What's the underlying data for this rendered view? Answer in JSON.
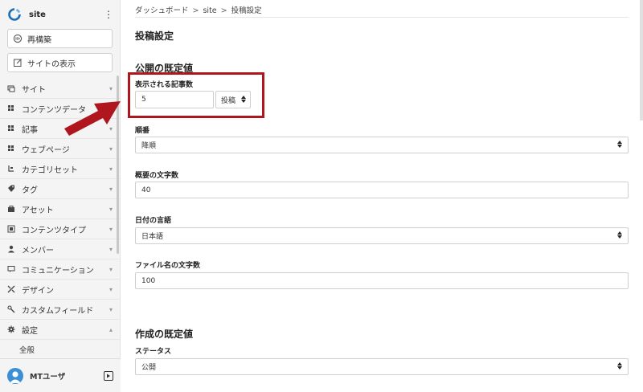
{
  "sidebar": {
    "site_name": "site",
    "buttons": [
      {
        "label": "再構築",
        "icon": "rebuild-icon"
      },
      {
        "label": "サイトの表示",
        "icon": "external-view-icon"
      }
    ],
    "items": [
      {
        "label": "サイト",
        "icon": "site-icon"
      },
      {
        "label": "コンテンツデータ",
        "icon": "content-data-icon"
      },
      {
        "label": "記事",
        "icon": "entry-icon"
      },
      {
        "label": "ウェブページ",
        "icon": "webpage-icon"
      },
      {
        "label": "カテゴリセット",
        "icon": "category-set-icon"
      },
      {
        "label": "タグ",
        "icon": "tag-icon"
      },
      {
        "label": "アセット",
        "icon": "asset-icon"
      },
      {
        "label": "コンテンツタイプ",
        "icon": "content-type-icon"
      },
      {
        "label": "メンバー",
        "icon": "member-icon"
      },
      {
        "label": "コミュニケーション",
        "icon": "communication-icon"
      },
      {
        "label": "デザイン",
        "icon": "design-icon"
      },
      {
        "label": "カスタムフィールド",
        "icon": "custom-field-icon"
      },
      {
        "label": "設定",
        "icon": "gear-icon"
      }
    ],
    "sub_item": "全般",
    "user_name": "MTユーザ"
  },
  "main": {
    "breadcrumb": [
      "ダッシュボード",
      "site",
      "投稿設定"
    ],
    "breadcrumb_sep": ">",
    "page_title": "投稿設定",
    "section_public": "公開の既定値",
    "entries_label": "表示される記事数",
    "entries_value": "5",
    "entries_unit": "投稿",
    "order_label": "順番",
    "order_value": "降順",
    "excerpt_label": "概要の文字数",
    "excerpt_value": "40",
    "date_lang_label": "日付の言語",
    "date_lang_value": "日本語",
    "filename_label": "ファイル名の文字数",
    "filename_value": "100",
    "section_create": "作成の既定値",
    "status_label": "ステータス",
    "status_value": "公開"
  },
  "colors": {
    "highlight": "#b0161e",
    "arrow": "#b0161e",
    "accent": "#3b8fd6"
  }
}
